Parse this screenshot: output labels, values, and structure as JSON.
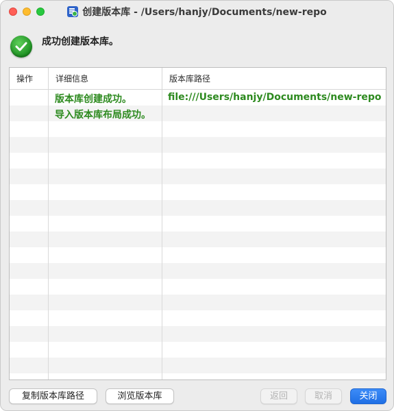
{
  "window": {
    "title": "创建版本库 - /Users/hanjy/Documents/new-repo"
  },
  "status": {
    "message": "成功创建版本库。"
  },
  "table": {
    "columns": [
      "操作",
      "详细信息",
      "版本库路径"
    ],
    "rows": [
      {
        "action": "",
        "detail": "版本库创建成功。",
        "path": "file:///Users/hanjy/Documents/new-repo"
      },
      {
        "action": "",
        "detail": "导入版本库布局成功。",
        "path": ""
      }
    ]
  },
  "buttons": {
    "copy_path": "复制版本库路径",
    "browse": "浏览版本库",
    "back": "返回",
    "cancel": "取消",
    "close": "关闭"
  },
  "colors": {
    "accent": "#1f6fe5",
    "success_text": "#2d8a1f"
  }
}
